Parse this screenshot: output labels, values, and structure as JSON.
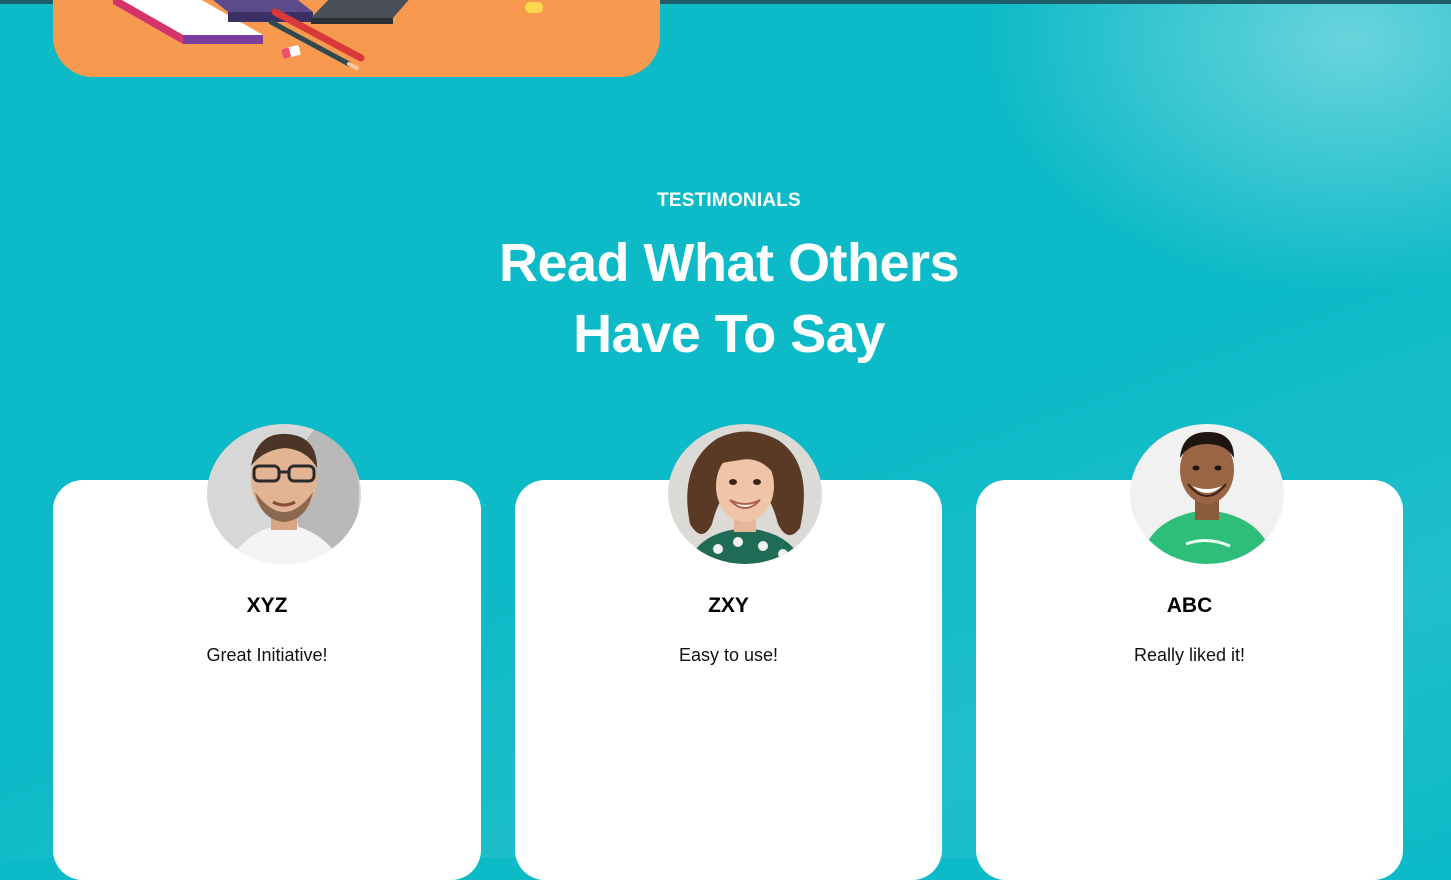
{
  "section": {
    "eyebrow": "TESTIMONIALS",
    "heading_line_1": "Read What Others",
    "heading_line_2": "Have To Say"
  },
  "testimonials": [
    {
      "name": "XYZ",
      "quote": "Great Initiative!",
      "avatar": "man-with-glasses-photo"
    },
    {
      "name": "ZXY",
      "quote": "Easy to use!",
      "avatar": "smiling-woman-curly-hair-photo"
    },
    {
      "name": "ABC",
      "quote": "Really liked it!",
      "avatar": "smiling-man-green-shirt-photo"
    }
  ],
  "colors": {
    "background": "#0dbac7",
    "hero_card": "#f7994f",
    "card": "#ffffff",
    "text_light": "#ffffff",
    "text_dark": "#000000"
  }
}
